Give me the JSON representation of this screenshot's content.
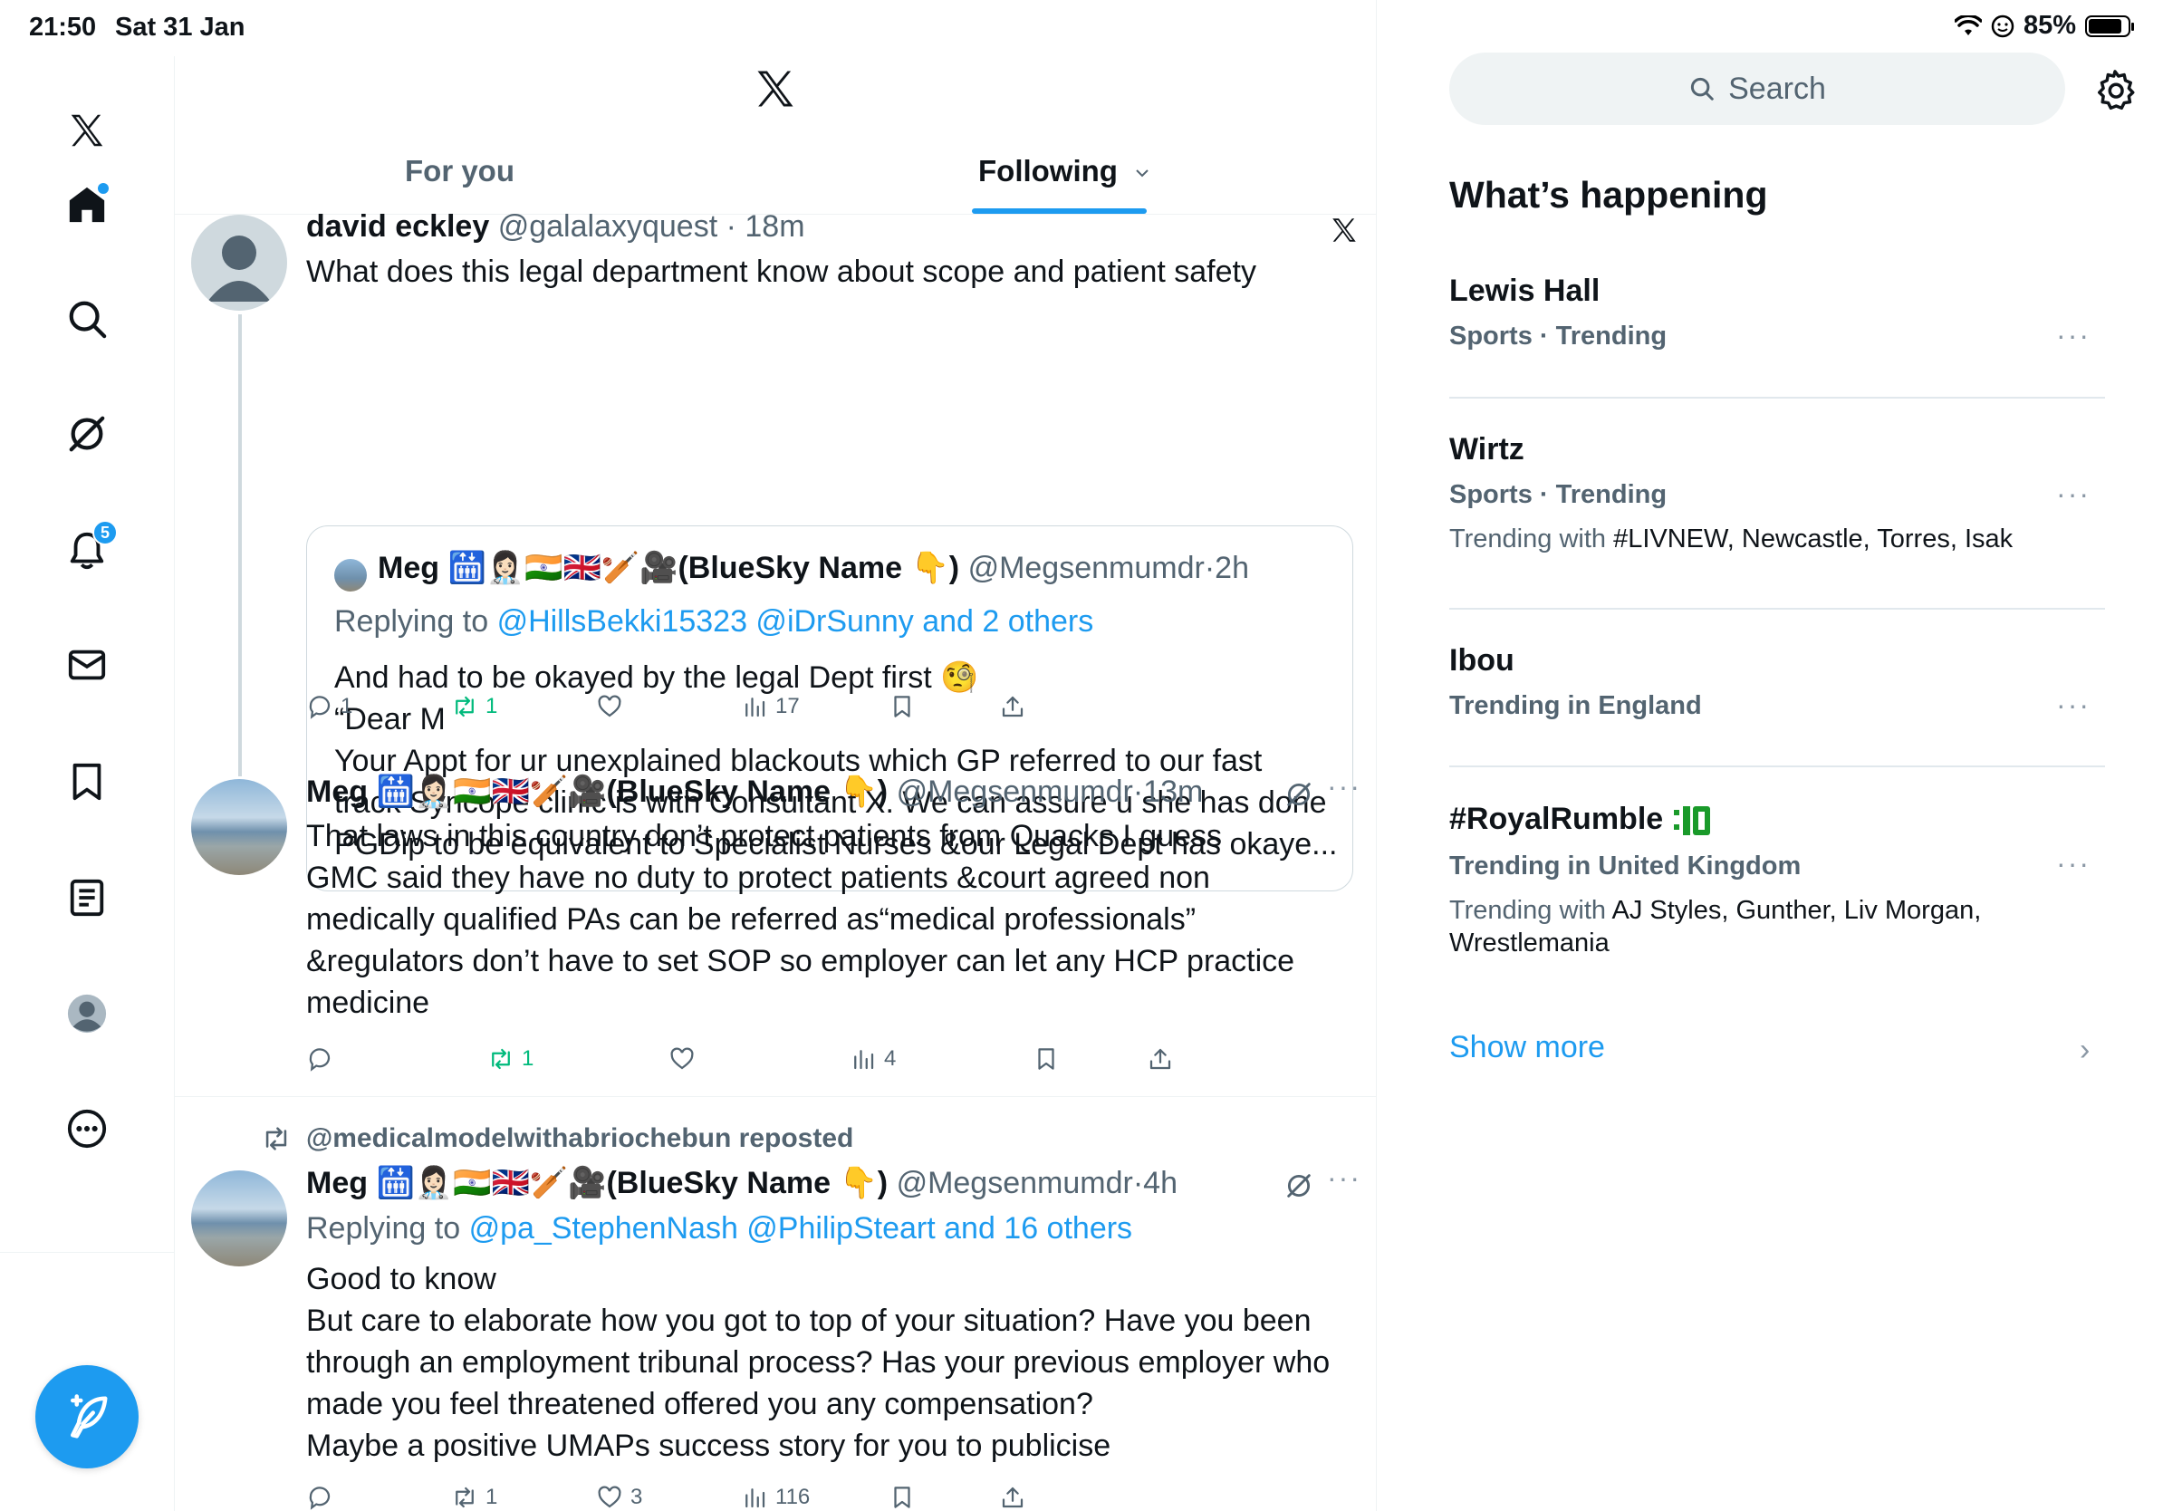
{
  "status": {
    "time": "21:50",
    "date": "Sat 31 Jan",
    "battery": "85%",
    "battery_level": 0.85
  },
  "nav": {
    "notifications_badge": "5"
  },
  "tabs": {
    "for_you": "For you",
    "following": "Following"
  },
  "post1": {
    "name": "david eckley",
    "handle": "@galalaxyquest",
    "time": "18m",
    "text": "What does this legal department know about scope and patient safety",
    "quote": {
      "name": "Meg 🛗👩🏻‍⚕️🇮🇳🇬🇧🏏🎥(BlueSky Name 👇)",
      "handle": "@Megsenmumdr",
      "time": "2h",
      "replying_label": "Replying to",
      "replying_to": "@HillsBekki15323 @iDrSunny and 2 others",
      "lines": [
        "And had to be okayed by the legal Dept first 🧐",
        "“Dear M",
        "Your Appt for ur unexplained blackouts which GP referred to our fast",
        "track Syncope clinic is with Consultant X. We can assure u she has done",
        "PGDip to be equivalent to Specialist Nurses &our Legal Dept has okaye..."
      ]
    },
    "stats": {
      "replies": "1",
      "reposts": "1",
      "likes": "",
      "views": "17"
    }
  },
  "post2": {
    "name": "Meg 🛗👩🏻‍⚕️🇮🇳🇬🇧🏏🎥(BlueSky Name 👇)",
    "handle": "@Megsenmumdr",
    "time": "13m",
    "lines": [
      "That laws in this country don’t protect patients from Quacks I guess",
      "GMC said they have no duty to protect patients &court agreed non",
      "medically qualified PAs can be referred as“medical professionals”",
      "&regulators don’t have to set SOP so employer can let any HCP practice",
      "medicine"
    ],
    "stats": {
      "replies": "",
      "reposts": "1",
      "likes": "",
      "views": "4"
    }
  },
  "post3": {
    "reposted_by": "@medicalmodelwithabriochebun reposted",
    "name": "Meg 🛗👩🏻‍⚕️🇮🇳🇬🇧🏏🎥(BlueSky Name 👇)",
    "handle": "@Megsenmumdr",
    "time": "4h",
    "replying_label": "Replying to",
    "replying_to": "@pa_StephenNash @PhilipSteart and 16 others",
    "lines": [
      "Good to know",
      "But care to elaborate how you got to top of your situation? Have you been",
      "through an employment tribunal process? Has your previous employer who",
      "made you feel threatened offered you any compensation?",
      "Maybe a positive UMAPs success story for you to publicise"
    ],
    "stats": {
      "replies": "",
      "reposts": "1",
      "likes": "3",
      "views": "116"
    }
  },
  "sidebar": {
    "search_placeholder": "Search",
    "title": "What’s happening",
    "trends": [
      {
        "title": "Lewis Hall",
        "meta": "Sports · Trending"
      },
      {
        "title": "Wirtz",
        "meta": "Sports · Trending",
        "with_label": "Trending with",
        "with": "#LIVNEW, Newcastle, Torres, Isak"
      },
      {
        "title": "Ibou",
        "meta": "Trending in England"
      },
      {
        "title": "#RoyalRumble",
        "meta": "Trending in United Kingdom",
        "with_label": "Trending with",
        "with": "AJ Styles, Gunther, Liv Morgan, Wrestlemania"
      }
    ],
    "show_more": "Show more"
  },
  "icons": {
    "nav": [
      "x-logo-icon",
      "home-icon",
      "search-icon",
      "grok-icon",
      "notifications-icon",
      "messages-icon",
      "bookmarks-icon",
      "lists-icon",
      "profile-icon",
      "more-icon"
    ],
    "actions": [
      "reply-icon",
      "repost-icon",
      "like-icon",
      "views-icon",
      "bookmark-icon",
      "share-icon"
    ]
  },
  "colors": {
    "accent": "#1d9bf0",
    "repost_green": "#00ba7c",
    "muted": "#536471",
    "text": "#0f1419"
  }
}
